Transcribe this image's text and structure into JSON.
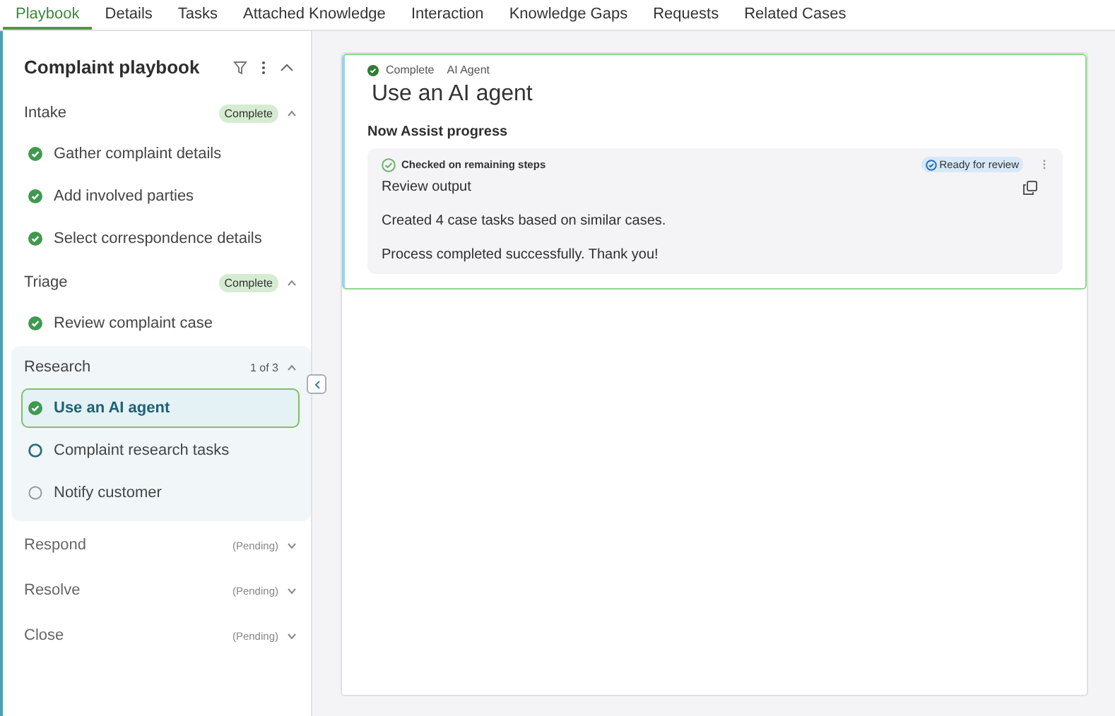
{
  "tabs": [
    {
      "label": "Playbook",
      "selected": true
    },
    {
      "label": "Details",
      "selected": false
    },
    {
      "label": "Tasks",
      "selected": false
    },
    {
      "label": "Attached Knowledge",
      "selected": false
    },
    {
      "label": "Interaction",
      "selected": false
    },
    {
      "label": "Knowledge Gaps",
      "selected": false
    },
    {
      "label": "Requests",
      "selected": false
    },
    {
      "label": "Related Cases",
      "selected": false
    }
  ],
  "playbook": {
    "title": "Complaint playbook",
    "stages": [
      {
        "name": "Intake",
        "status": "Complete",
        "kind": "complete",
        "expanded": true,
        "active": false,
        "steps": [
          {
            "label": "Gather complaint details",
            "kind": "done",
            "selected": false
          },
          {
            "label": "Add involved parties",
            "kind": "done",
            "selected": false
          },
          {
            "label": "Select correspondence details",
            "kind": "done",
            "selected": false
          }
        ]
      },
      {
        "name": "Triage",
        "status": "Complete",
        "kind": "complete",
        "expanded": true,
        "active": false,
        "steps": [
          {
            "label": "Review complaint case",
            "kind": "done",
            "selected": false
          }
        ]
      },
      {
        "name": "Research",
        "status": "1 of 3",
        "kind": "count",
        "expanded": true,
        "active": true,
        "steps": [
          {
            "label": "Use an AI agent",
            "kind": "done",
            "selected": true
          },
          {
            "label": "Complaint research tasks",
            "kind": "current",
            "selected": false
          },
          {
            "label": "Notify customer",
            "kind": "todo",
            "selected": false
          }
        ]
      },
      {
        "name": "Respond",
        "status": "(Pending)",
        "kind": "pending",
        "expanded": false,
        "active": false
      },
      {
        "name": "Resolve",
        "status": "(Pending)",
        "kind": "pending",
        "expanded": false,
        "active": false
      },
      {
        "name": "Close",
        "status": "(Pending)",
        "kind": "pending",
        "expanded": false,
        "active": false
      }
    ]
  },
  "activity": {
    "status": "Complete",
    "type": "AI Agent",
    "title": "Use an AI agent",
    "section": "Now Assist progress",
    "progress": {
      "step": "Checked on remaining steps",
      "badge": "Ready for review",
      "heading": "Review output",
      "lines": [
        "Created 4 case tasks based on similar cases.",
        "Process completed successfully. Thank you!"
      ]
    }
  }
}
